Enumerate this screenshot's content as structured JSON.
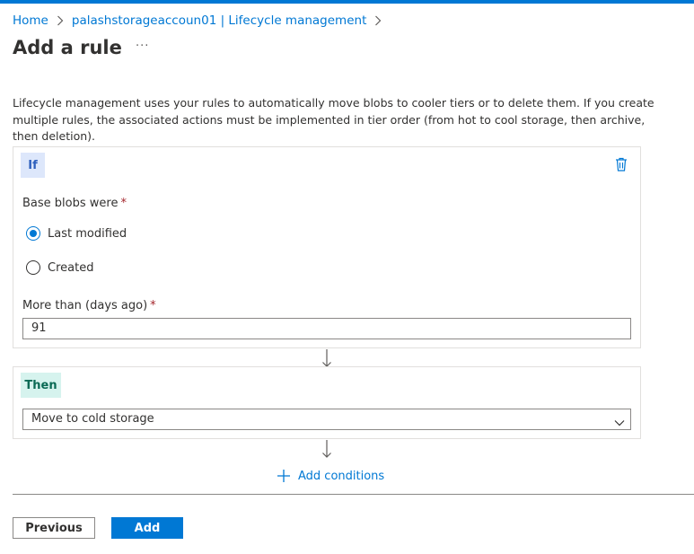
{
  "breadcrumb": {
    "items": [
      "Home",
      "palashstorageaccoun01 | Lifecycle management"
    ]
  },
  "page": {
    "title": "Add a rule",
    "more_label": "···",
    "description": "Lifecycle management uses your rules to automatically move blobs to cooler tiers or to delete them. If you create multiple rules, the associated actions must be implemented in tier order (from hot to cool storage, then archive, then deletion)."
  },
  "if_block": {
    "badge": "If",
    "base_blobs_label": "Base blobs were",
    "required_mark": "*",
    "options": [
      {
        "label": "Last modified",
        "checked": true
      },
      {
        "label": "Created",
        "checked": false
      }
    ],
    "days_label": "More than (days ago)",
    "days_value": "91"
  },
  "then_block": {
    "badge": "Then",
    "action_value": "Move to cold storage"
  },
  "add_conditions_label": "Add conditions",
  "footer": {
    "previous_label": "Previous",
    "add_label": "Add"
  },
  "colors": {
    "accent": "#0078d4",
    "required": "#a4262c",
    "if_badge_bg": "#dde7fb",
    "then_badge_bg": "#d6f3ee"
  },
  "icons": {
    "breadcrumb_separator": "chevron-right-icon",
    "delete": "trash-icon",
    "flow_arrow": "arrow-down-icon",
    "add": "plus-icon",
    "select": "chevron-down-icon"
  }
}
